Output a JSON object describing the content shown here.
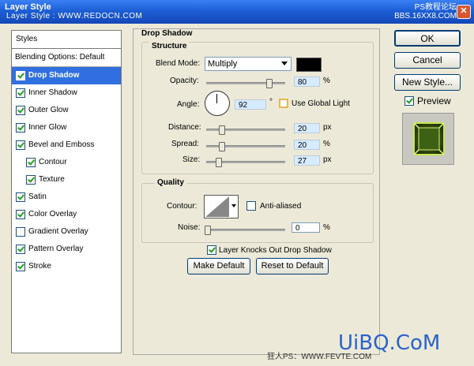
{
  "window": {
    "title": "Layer Style",
    "subtitle": "Layer Style : WWW.REDOCN.COM",
    "watermark_top": "PS教程论坛",
    "watermark_top2": "BBS.16XX8.COM",
    "close_label": "✕"
  },
  "left": {
    "styles_header": "Styles",
    "blending": "Blending Options: Default",
    "items": [
      {
        "label": "Drop Shadow",
        "checked": true
      },
      {
        "label": "Inner Shadow",
        "checked": true
      },
      {
        "label": "Outer Glow",
        "checked": true
      },
      {
        "label": "Inner Glow",
        "checked": true
      },
      {
        "label": "Bevel and Emboss",
        "checked": true
      },
      {
        "label": "Contour",
        "checked": true
      },
      {
        "label": "Texture",
        "checked": true
      },
      {
        "label": "Satin",
        "checked": true
      },
      {
        "label": "Color Overlay",
        "checked": true
      },
      {
        "label": "Gradient Overlay",
        "checked": false
      },
      {
        "label": "Pattern Overlay",
        "checked": true
      },
      {
        "label": "Stroke",
        "checked": true
      }
    ]
  },
  "drop_shadow": {
    "title": "Drop Shadow",
    "structure": "Structure",
    "blend_mode_label": "Blend Mode:",
    "blend_mode_value": "Multiply",
    "shadow_color": "#000000",
    "opacity_label": "Opacity:",
    "opacity_value": "80",
    "angle_label": "Angle:",
    "angle_value": "92",
    "degree": "°",
    "global_light_label": "Use Global Light",
    "global_light_checked": false,
    "distance_label": "Distance:",
    "distance_value": "20",
    "spread_label": "Spread:",
    "spread_value": "20",
    "size_label": "Size:",
    "size_value": "27",
    "unit_pct": "%",
    "unit_px": "px",
    "quality": "Quality",
    "contour_label": "Contour:",
    "anti_aliased_label": "Anti-aliased",
    "noise_label": "Noise:",
    "noise_value": "0",
    "knocks_out_label": "Layer Knocks Out Drop Shadow",
    "knocks_out_checked": true,
    "make_default": "Make Default",
    "reset_default": "Reset to Default"
  },
  "right": {
    "ok": "OK",
    "cancel": "Cancel",
    "new_style": "New Style...",
    "preview_label": "Preview",
    "preview_checked": true
  },
  "footer": {
    "url": "狂人PS：WWW.FEVTE.COM",
    "logo": "UiBQ.CoM"
  }
}
